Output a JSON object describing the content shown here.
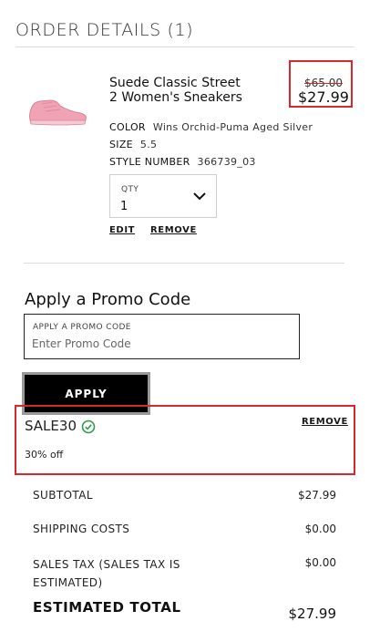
{
  "order": {
    "title": "ORDER DETAILS (1)"
  },
  "item": {
    "name_line1": "Suede Classic Street",
    "name_line2": "2 Women's Sneakers",
    "old_price": "$65.00",
    "new_price": "$27.99",
    "color_label": "COLOR",
    "color_value": "Wins Orchid-Puma Aged Silver",
    "size_label": "SIZE",
    "size_value": "5.5",
    "style_label": "STYLE NUMBER",
    "style_value": "366739_03",
    "qty_label": "QTY",
    "qty_value": "1",
    "edit_label": "EDIT",
    "remove_label": "REMOVE",
    "image_icon": "pink-sneaker-image"
  },
  "promo": {
    "title": "Apply a Promo Code",
    "field_label": "APPLY A PROMO CODE",
    "placeholder": "Enter Promo Code",
    "apply_label": "APPLY",
    "code": "SALE30",
    "discount": "30% off",
    "remove_label": "REMOVE",
    "check_icon": "check-circle-icon"
  },
  "summary": {
    "subtotal_label": "SUBTOTAL",
    "subtotal_value": "$27.99",
    "shipping_label": "SHIPPING COSTS",
    "shipping_value": "$0.00",
    "tax_label_line1": "SALES TAX (SALES TAX IS",
    "tax_label_line2": "ESTIMATED)",
    "tax_value": "$0.00",
    "total_label": "ESTIMATED TOTAL",
    "total_value": "$27.99"
  },
  "colors": {
    "highlight": "#d9272e",
    "check": "#2e9b4a",
    "button_bg": "#000000"
  }
}
